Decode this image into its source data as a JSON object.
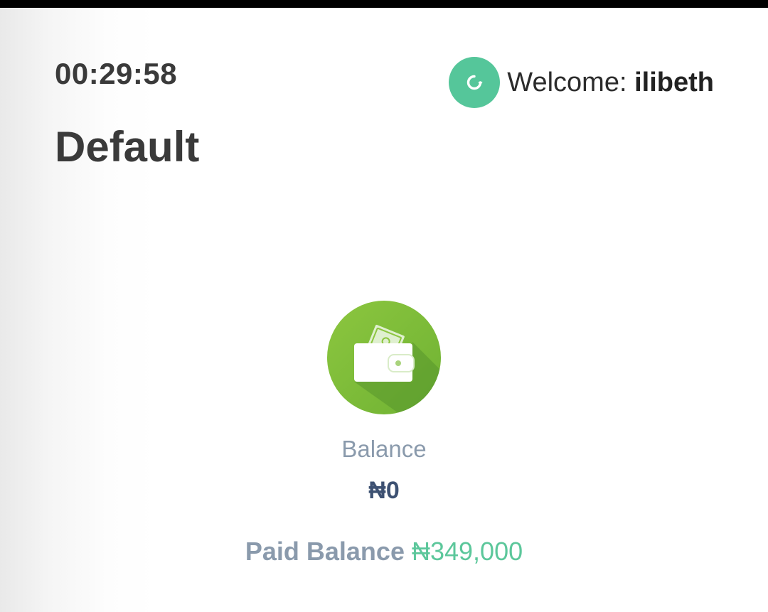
{
  "status_bar": {
    "color": "#000000"
  },
  "header": {
    "timer": "00:29:58",
    "title": "Default",
    "welcome_label": "Welcome:",
    "username": "ilibeth",
    "refresh_icon": "refresh-icon",
    "accent_color": "#55c69a"
  },
  "wallet": {
    "icon": "wallet-icon",
    "icon_color": "#7cc242",
    "balance_label": "Balance",
    "balance_value": "₦0",
    "paid_balance_label": "Paid Balance",
    "paid_balance_value": "₦349,000",
    "paid_value_color": "#5cc79b"
  }
}
